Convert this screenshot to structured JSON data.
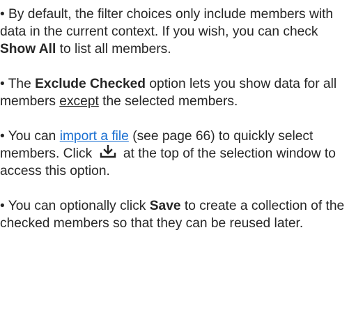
{
  "paragraphs": {
    "p1": {
      "pre": " • By default, the filter choices only include members with data in the current context. If you wish, you can check ",
      "bold": "Show All",
      "post": " to list all members."
    },
    "p2": {
      "pre": " • The ",
      "bold": "Exclude Checked",
      "mid": " option lets you show data for all members ",
      "underline": "except",
      "post": " the selected members."
    },
    "p3": {
      "pre": " • You can ",
      "link": "import a file",
      "mid": " (see page 66) to quickly select members. Click ",
      "icon": "import-download-icon",
      "post": " at the top of the selection window to access this option."
    },
    "p4": {
      "pre": " • You can optionally click ",
      "bold": "Save",
      "post": " to create a collection of the checked members so that they can be reused later."
    }
  },
  "colors": {
    "text": "#262626",
    "link": "#1a6fd1",
    "icon": "#222222"
  }
}
